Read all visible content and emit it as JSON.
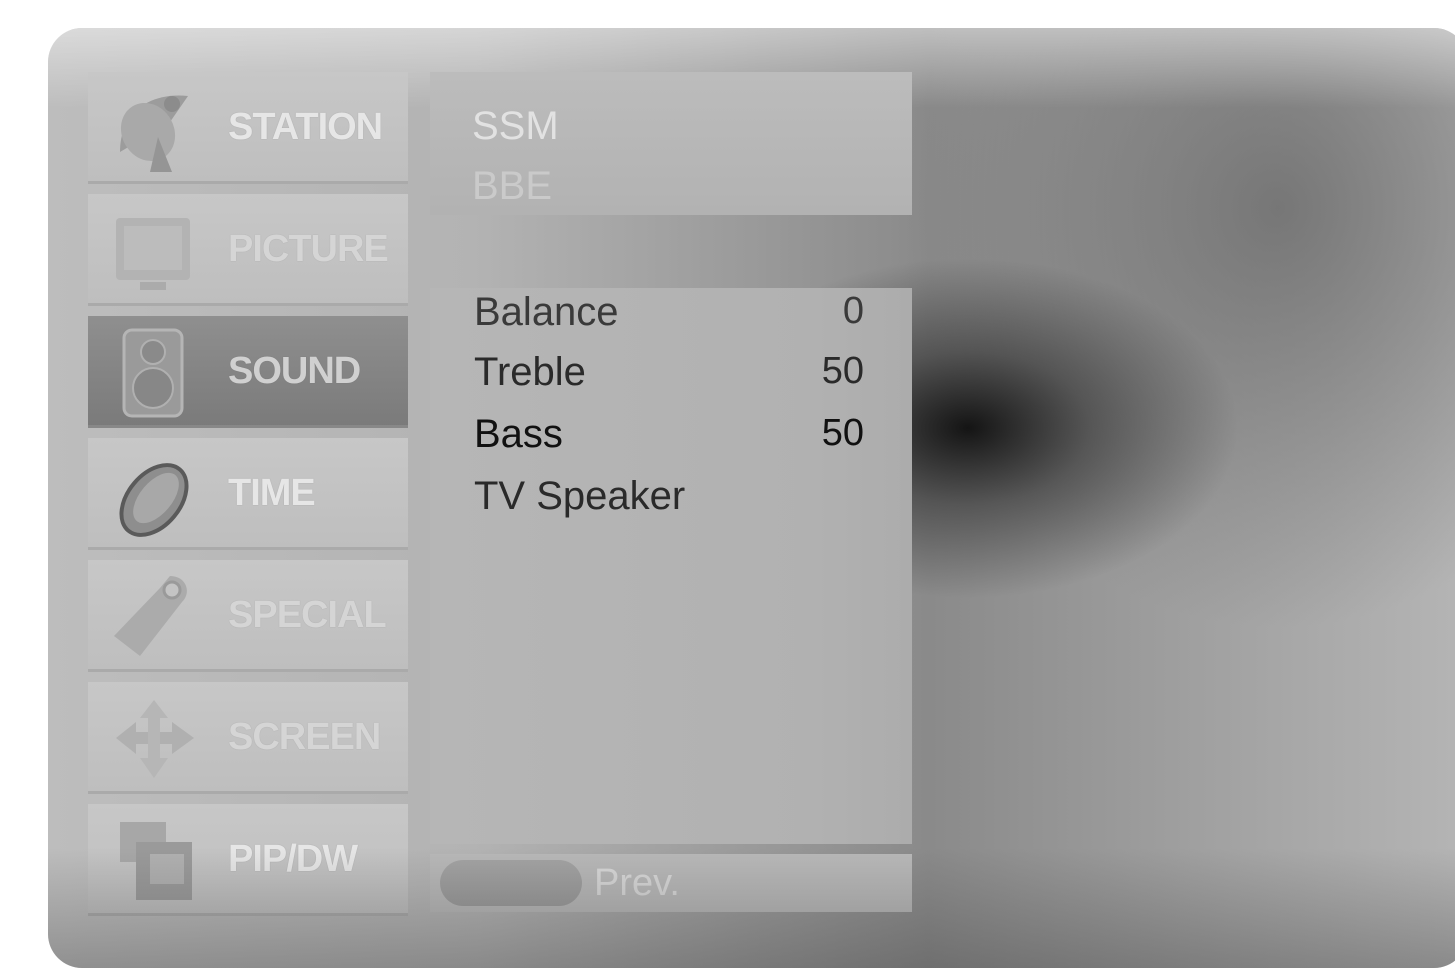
{
  "menu": {
    "items": [
      {
        "label": "STATION",
        "icon": "satellite-dish-icon"
      },
      {
        "label": "PICTURE",
        "icon": "tv-screen-icon"
      },
      {
        "label": "SOUND",
        "icon": "speaker-icon"
      },
      {
        "label": "TIME",
        "icon": "clock-icon"
      },
      {
        "label": "SPECIAL",
        "icon": "tag-icon"
      },
      {
        "label": "SCREEN",
        "icon": "arrows-icon"
      },
      {
        "label": "PIP/DW",
        "icon": "pip-windows-icon"
      }
    ],
    "active": "SOUND"
  },
  "sound_top_options": [
    "SSM",
    "BBE"
  ],
  "sound_options": [
    {
      "label": "Balance",
      "value": "0"
    },
    {
      "label": "Treble",
      "value": "50"
    },
    {
      "label": "Bass",
      "value": "50"
    },
    {
      "label": "TV Speaker",
      "value": ""
    }
  ],
  "hint": {
    "prev_label": "Prev."
  }
}
